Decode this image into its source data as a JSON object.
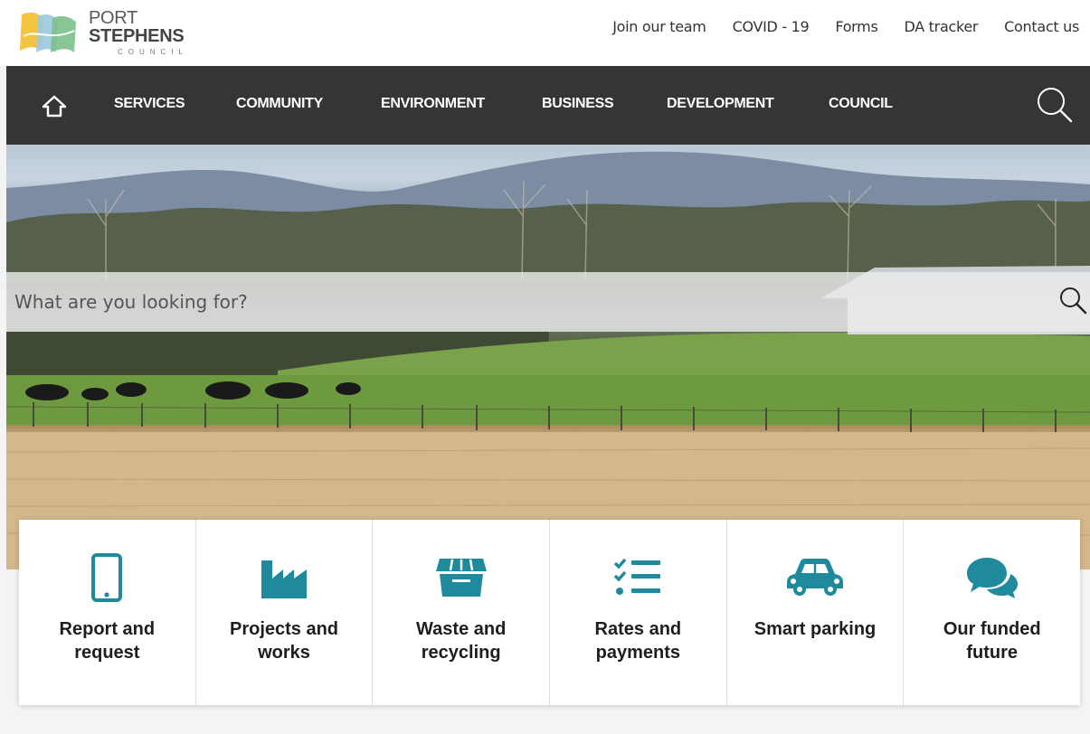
{
  "header": {
    "logo": {
      "name_regular": "PORT ",
      "name_bold": "STEPHENS",
      "subtitle": "COUNCIL"
    },
    "utility_links": [
      "Join our team",
      "COVID - 19",
      "Forms",
      "DA tracker",
      "Contact us"
    ]
  },
  "main_nav": {
    "home_icon": "home-icon",
    "items": [
      "SERVICES",
      "COMMUNITY",
      "ENVIRONMENT",
      "BUSINESS",
      "DEVELOPMENT",
      "COUNCIL"
    ],
    "search_icon": "search-icon"
  },
  "hero": {
    "search": {
      "placeholder": "What are you looking for?",
      "value": ""
    }
  },
  "tiles": [
    {
      "label": "Report and request",
      "icon": "mobile-phone-icon"
    },
    {
      "label": "Projects and works",
      "icon": "factory-icon"
    },
    {
      "label": "Waste and recycling",
      "icon": "bin-icon"
    },
    {
      "label": "Rates and payments",
      "icon": "checklist-icon"
    },
    {
      "label": "Smart parking",
      "icon": "car-icon"
    },
    {
      "label": "Our funded future",
      "icon": "chat-bubbles-icon"
    }
  ],
  "colors": {
    "nav_bg": "#353535",
    "accent_teal": "#1e8a9c",
    "tile_text": "#1e1e1e"
  }
}
